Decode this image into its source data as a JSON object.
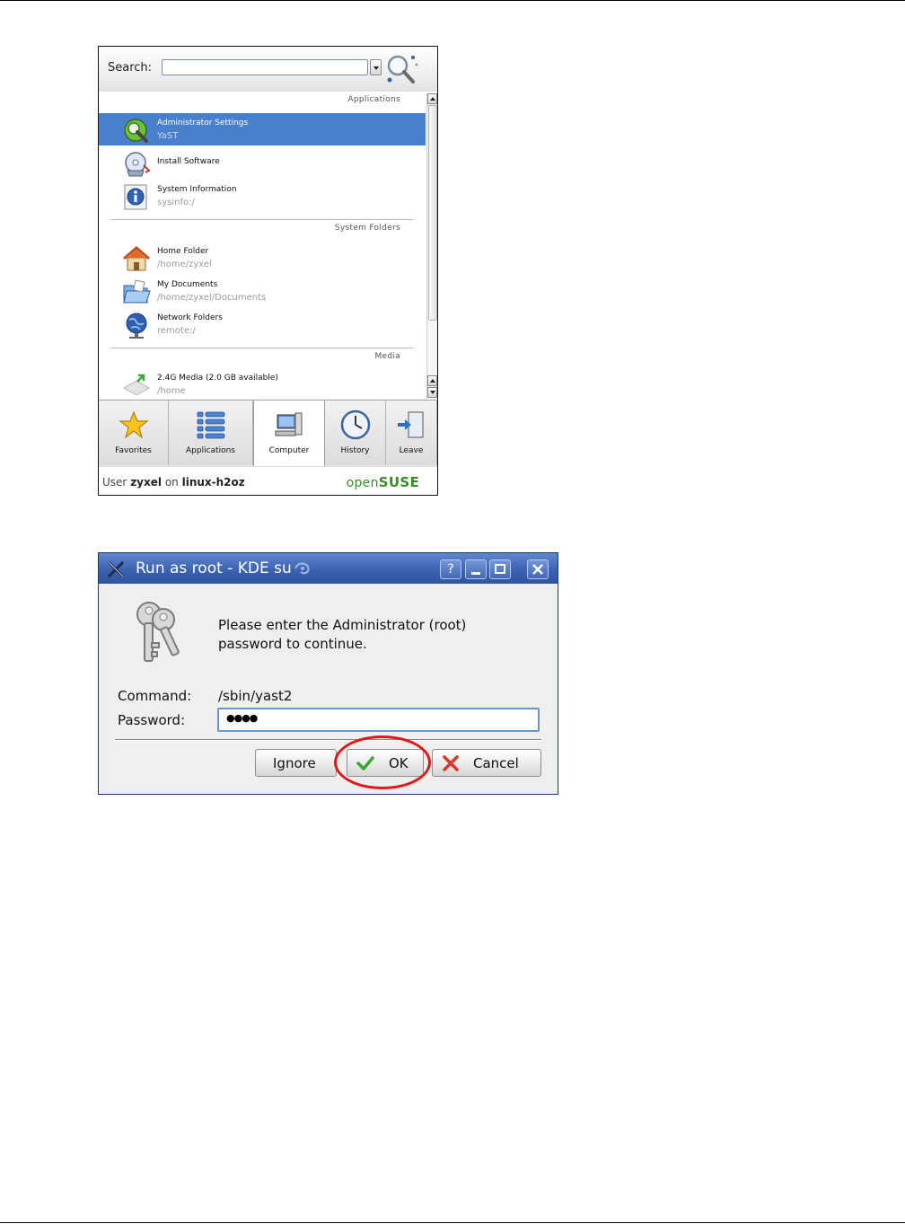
{
  "kickoff": {
    "search": {
      "label": "Search:",
      "value": "",
      "placeholder": ""
    },
    "sections": {
      "applications": "Applications",
      "system_folders": "System Folders",
      "media": "Media"
    },
    "items": [
      {
        "title": "Administrator Settings",
        "subtitle": "YaST",
        "icon": "yast-icon",
        "selected": true
      },
      {
        "title": "Install Software",
        "subtitle": "",
        "icon": "install-software-icon",
        "selected": false
      },
      {
        "title": "System Information",
        "subtitle": "sysinfo:/",
        "icon": "info-icon",
        "selected": false
      },
      {
        "title": "Home Folder",
        "subtitle": "/home/zyxel",
        "icon": "home-icon",
        "selected": false
      },
      {
        "title": "My Documents",
        "subtitle": "/home/zyxel/Documents",
        "icon": "folder-icon",
        "selected": false
      },
      {
        "title": "Network Folders",
        "subtitle": "remote:/",
        "icon": "network-icon",
        "selected": false
      },
      {
        "title": "2.4G Media (2.0 GB available)",
        "subtitle": "/home",
        "icon": "media-icon",
        "selected": false
      }
    ],
    "tabs": [
      {
        "label": "Favorites",
        "icon": "star-icon"
      },
      {
        "label": "Applications",
        "icon": "applications-list-icon"
      },
      {
        "label": "Computer",
        "icon": "computer-icon",
        "active": true
      },
      {
        "label": "History",
        "icon": "clock-icon"
      },
      {
        "label": "Leave",
        "icon": "leave-icon"
      }
    ],
    "footer": {
      "user_prefix": "User",
      "user": "zyxel",
      "on": "on",
      "host": "linux-h2oz",
      "brand_prefix": "open",
      "brand_suffix": "SUSE"
    }
  },
  "dialog": {
    "title": "Run as root - KDE su",
    "window_buttons": {
      "help": "?",
      "minimize": "_",
      "maximize": "□",
      "close": "✕"
    },
    "message": "Please enter the Administrator (root) password to continue.",
    "command_label": "Command:",
    "command_value": "/sbin/yast2",
    "password_label": "Password:",
    "password_mask": "●●●●",
    "buttons": {
      "ignore": "Ignore",
      "ok": "OK",
      "cancel": "Cancel"
    },
    "highlight_color": "#e0161a"
  }
}
